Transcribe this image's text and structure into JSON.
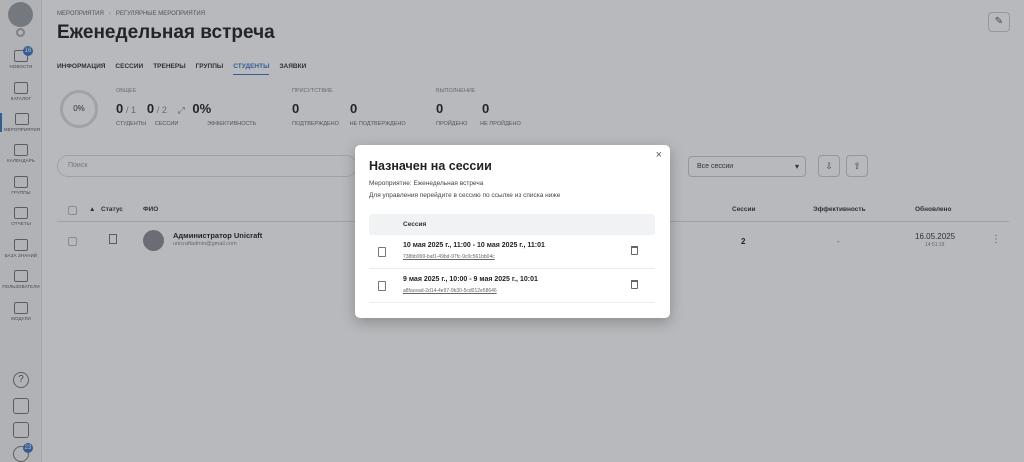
{
  "breadcrumb": {
    "root": "Мероприятия",
    "current": "Регулярные мероприятия"
  },
  "page": {
    "title": "Еженедельная встреча"
  },
  "tabs": [
    "Информация",
    "Сессии",
    "Тренеры",
    "Группы",
    "Студенты",
    "Заявки"
  ],
  "active_tab": "Студенты",
  "sidebar": {
    "news_badge": "16",
    "bottom_badge": "23",
    "items": [
      {
        "label": "Новости",
        "icon": "news-icon"
      },
      {
        "label": "Каталог",
        "icon": "catalog-icon"
      },
      {
        "label": "Мероприятия",
        "icon": "events-icon"
      },
      {
        "label": "Календарь",
        "icon": "calendar-icon"
      },
      {
        "label": "Группы",
        "icon": "groups-icon"
      },
      {
        "label": "Отчеты",
        "icon": "reports-icon"
      },
      {
        "label": "База знаний",
        "icon": "knowledge-icon"
      },
      {
        "label": "Пользователи",
        "icon": "users-icon"
      },
      {
        "label": "Модули",
        "icon": "modules-icon"
      }
    ]
  },
  "stats": {
    "ring": "0%",
    "total": {
      "title": "Общее",
      "students": "0",
      "students_of": "/ 1",
      "students_cap": "Студенты",
      "sessions": "0",
      "sessions_of": "/ 2",
      "sessions_cap": "Сессии",
      "eff": "0%",
      "eff_cap": "Эффективность"
    },
    "attendance": {
      "title": "Присутствие",
      "confirmed": "0",
      "confirmed_cap": "Подтверждено",
      "unconfirmed": "0",
      "unconfirmed_cap": "Не подтверждено"
    },
    "completion": {
      "title": "Выполнение",
      "passed": "0",
      "passed_cap": "Пройдено",
      "failed": "0",
      "failed_cap": "Не пройдено"
    }
  },
  "filters": {
    "search_placeholder": "Поиск",
    "sessions_select": "Все сессии"
  },
  "table": {
    "headers": {
      "status": "Статус",
      "name": "ФИО",
      "sessions": "Сессии",
      "efficiency": "Эффективность",
      "updated": "Обновлено"
    },
    "rows": [
      {
        "name": "Администратор Unicraft",
        "email": "unicraftadmin@gmail.com",
        "sessions": "2",
        "efficiency": "-",
        "date": "16.05.2025",
        "time": "14:51:18"
      }
    ]
  },
  "modal": {
    "title": "Назначен на сессии",
    "event_line": "Мероприятие: Еженедельная встреча",
    "hint": "Для управления перейдите в сессию по ссылке из списка ниже",
    "column": "Сессия",
    "sessions": [
      {
        "title": "10 мая 2025 г., 11:00 - 10 мая 2025 г., 11:01",
        "id": "738bb999-baf1-49bd-97fc-9c0c561bb04c"
      },
      {
        "title": "9 мая 2025 г., 10:00 - 9 мая 2025 г., 10:01",
        "id": "a8facead-2d14-4e97-9b30-5cd012e58646"
      }
    ]
  }
}
